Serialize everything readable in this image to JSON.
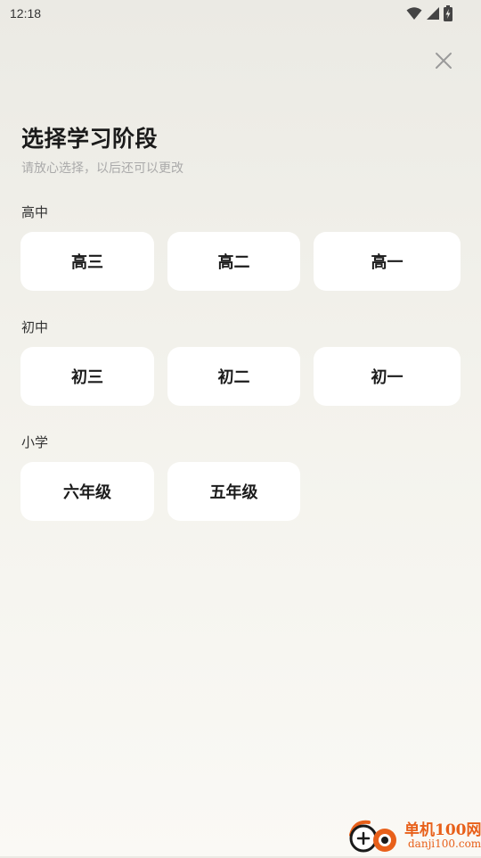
{
  "status_bar": {
    "time": "12:18",
    "icons": [
      "wifi-icon",
      "signal-icon",
      "battery-charging-icon"
    ]
  },
  "header": {
    "close_icon": "close-icon",
    "title": "选择学习阶段",
    "subtitle": "请放心选择，以后还可以更改"
  },
  "sections": [
    {
      "label": "高中",
      "grades": [
        "高三",
        "高二",
        "高一"
      ]
    },
    {
      "label": "初中",
      "grades": [
        "初三",
        "初二",
        "初一"
      ]
    },
    {
      "label": "小学",
      "grades": [
        "六年级",
        "五年级"
      ]
    }
  ],
  "watermark": {
    "name": "单机100网",
    "url": "danji100.com"
  },
  "colors": {
    "background_top": "#ebeae4",
    "background_bottom": "#faf9f5",
    "card": "#ffffff",
    "title_text": "#1b1b1b",
    "subtitle_text": "#aaaaaa",
    "watermark": "#e8601a"
  }
}
